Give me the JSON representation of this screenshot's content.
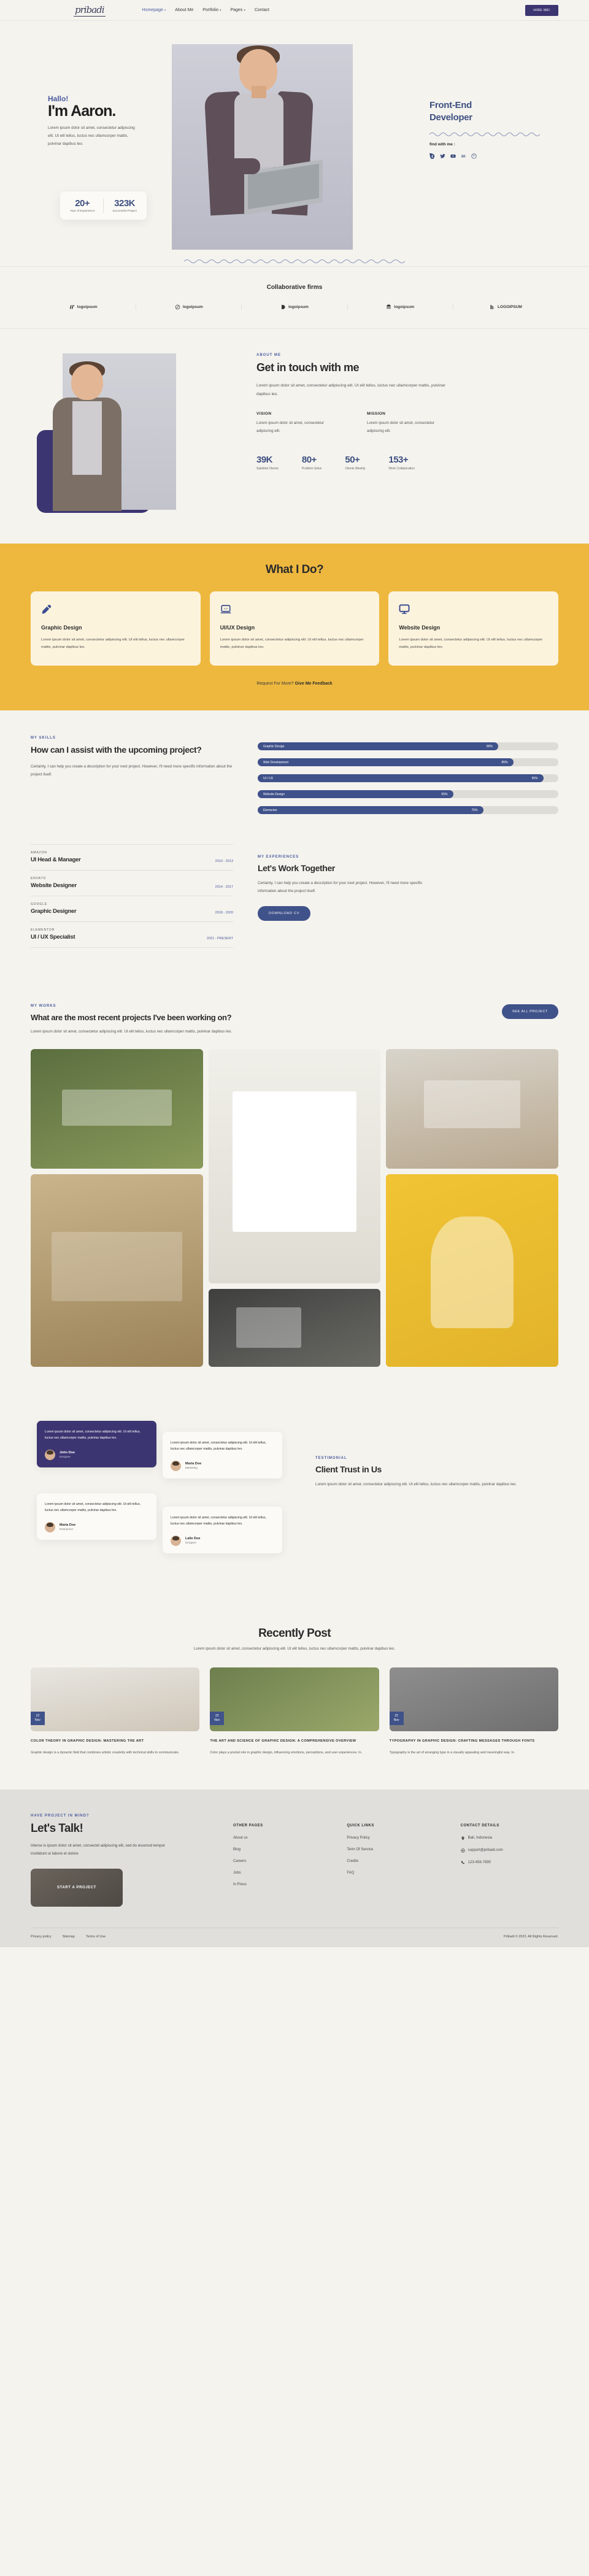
{
  "nav": {
    "logo": "pribadi",
    "items": [
      {
        "label": "Homepage",
        "caret": true,
        "active": true
      },
      {
        "label": "About Me",
        "caret": false,
        "active": false
      },
      {
        "label": "Portfolio",
        "caret": true,
        "active": false
      },
      {
        "label": "Pages",
        "caret": true,
        "active": false
      },
      {
        "label": "Contact",
        "caret": false,
        "active": false
      }
    ],
    "cta": "HIRE ME!"
  },
  "hero": {
    "greeting": "Hallo!",
    "name": "I'm Aaron.",
    "description": "Lorem ipsum dolor sit amet, consectetur adipiscing elit. Ut elit tellus, luctus nec ullamcorper mattis, pulvinar dapibus leo.",
    "stats": [
      {
        "value": "20+",
        "label": "Year of Experience"
      },
      {
        "value": "323K",
        "label": "Successful Project"
      }
    ],
    "role_line1": "Front-End",
    "role_line2": "Developer",
    "find_label": "find with me :",
    "socials": [
      "facebook-icon",
      "twitter-icon",
      "youtube-icon",
      "behance-icon",
      "pinterest-icon"
    ]
  },
  "collab": {
    "title": "Collaborative firms",
    "logos": [
      {
        "name": "logoipsum",
        "mark": "slashes-mark"
      },
      {
        "name": "logoipsum",
        "mark": "circle-slash-mark"
      },
      {
        "name": "logoipsum",
        "mark": "half-circle-mark"
      },
      {
        "name": "logoipsum",
        "mark": "waves-mark"
      },
      {
        "name": "LOGOIPSUM",
        "mark": "bars-mark"
      }
    ]
  },
  "about": {
    "eyebrow": "ABOUT ME",
    "title": "Get in touch with me",
    "paragraph": "Lorem ipsum dolor sit amet, consectetur adipiscing elit. Ut elit tellus, luctus nec ullamcorper mattis, pulvinar dapibus leo.",
    "blocks": [
      {
        "heading": "VISION",
        "text": "Lorem ipsum dolor sit amet, consectetur adipiscing elit."
      },
      {
        "heading": "MISSION",
        "text": "Lorem ipsum dolor sit amet, consectetur adipiscing elit."
      }
    ],
    "stats": [
      {
        "value": "39K",
        "label": "Satisfied Clients"
      },
      {
        "value": "80+",
        "label": "Problem Solve"
      },
      {
        "value": "50+",
        "label": "Clients Weekly"
      },
      {
        "value": "153+",
        "label": "Work Collaboration"
      }
    ]
  },
  "services": {
    "title": "What I Do?",
    "cards": [
      {
        "icon": "pen-icon",
        "title": "Graphic Design",
        "text": "Lorem ipsum dolor sit amet, consectetur adipiscing elit. Ut elit tellus, luctus nec ullamcorper mattis, pulvinar dapibus leo."
      },
      {
        "icon": "laptop-code-icon",
        "title": "UI/UX Design",
        "text": "Lorem ipsum dolor sit amet, consectetur adipiscing elit. Ut elit tellus, luctus nec ullamcorper mattis, pulvinar dapibus leo."
      },
      {
        "icon": "monitor-icon",
        "title": "Website Design",
        "text": "Lorem ipsum dolor sit amet, consectetur adipiscing elit. Ut elit tellus, luctus nec ullamcorper mattis, pulvinar dapibus leo."
      }
    ],
    "footer_text": "Request For More?",
    "footer_link": "Give Me Feedback"
  },
  "skills": {
    "eyebrow": "MY SKILLS",
    "title": "How can I assist with the upcoming project?",
    "paragraph": "Certainly, I can help you create a description for your next project. However, I'll need more specific information about the project itself.",
    "bars": [
      {
        "name": "Graphic Design",
        "percent": "80%",
        "value": 80
      },
      {
        "name": "Web Development",
        "percent": "85%",
        "value": 85
      },
      {
        "name": "UI / UX",
        "percent": "95%",
        "value": 95
      },
      {
        "name": "Website Design",
        "percent": "65%",
        "value": 65
      },
      {
        "name": "Elementor",
        "percent": "75%",
        "value": 75
      }
    ]
  },
  "experience": {
    "items": [
      {
        "company": "AMAZON",
        "title": "UI Head & Manager",
        "years": "2010 - 2013"
      },
      {
        "company": "ENVATO",
        "title": "Website Designer",
        "years": "2014 - 2017"
      },
      {
        "company": "GOOGLE",
        "title": "Graphic Designer",
        "years": "2018 - 2020"
      },
      {
        "company": "ELEMENTOR",
        "title": "UI / UX Specialist",
        "years": "2021 - PRESENT"
      }
    ],
    "eyebrow": "MY EXPERIENCES",
    "title": "Let's Work Together",
    "paragraph": "Certainly, I can help you create a description for your next project. However, I'll need more specific information about the project itself.",
    "cta": "DOWNLOAD CV"
  },
  "works": {
    "eyebrow": "MY WORKS",
    "title": "What are the most recent projects I've been working on?",
    "paragraph": "Lorem ipsum dolor sit amet, consectetur adipiscing elit. Ut elit tellus, luctus nec ullamcorper mattis, pulvinar dapibus leo.",
    "cta": "SEE ALL PROJECT"
  },
  "testimonials": {
    "cards": [
      {
        "text": "Lorem ipsum dolor sit amet, consectetur adipiscing elit. Ut elit tellus, luctus nec ullamcorper mattis, pulvinar dapibus leo.",
        "name": "John Doe",
        "role": "Designer",
        "theme": "dark"
      },
      {
        "text": "Lorem ipsum dolor sit amet, consectetur adipiscing elit. Ut elit tellus, luctus nec ullamcorper mattis, pulvinar dapibus leo.",
        "name": "Maria Doe",
        "role": "Marketing",
        "theme": "light"
      },
      {
        "text": "Lorem ipsum dolor sit amet, consectetur adipiscing elit. Ut elit tellus, luctus nec ullamcorper mattis, pulvinar dapibus leo.",
        "name": "Maria Doe",
        "role": "Enterpriner",
        "theme": "light"
      },
      {
        "text": "Lorem ipsum dolor sit amet, consectetur adipiscing elit. Ut elit tellus, luctus nec ullamcorper mattis, pulvinar dapibus leo.",
        "name": "Lalle Doe",
        "role": "Designer",
        "theme": "light"
      }
    ],
    "eyebrow": "TESTIMONIAL",
    "title": "Client Trust in Us",
    "paragraph": "Lorem ipsum dolor sit amet, consectetur adipiscing elit. Ut elit tellus, luctus nec ullamcorper mattis, pulvinar dapibus leo."
  },
  "blog": {
    "title": "Recently Post",
    "subtitle": "Lorem ipsum dolor sit amet, consectetur adipiscing elit. Ut elit tellus, luctus nec ullamcorper mattis, pulvinar dapibus leo.",
    "posts": [
      {
        "day": "22",
        "month": "Nov",
        "title": "COLOR THEORY IN GRAPHIC DESIGN: MASTERING THE ART",
        "text": "Graphic design is a dynamic field that combines artistic creativity with technical skills to communicate."
      },
      {
        "day": "22",
        "month": "Nov",
        "title": "THE ART AND SCIENCE OF GRAPHIC DESIGN: A COMPREHENSIVE OVERVIEW",
        "text": "Color plays a pivotal role in graphic design, influencing emotions, perceptions, and user experiences. In."
      },
      {
        "day": "22",
        "month": "Nov",
        "title": "TYPOGRAPHY IN GRAPHIC DESIGN: CRAFTING MESSAGES THROUGH FONTS",
        "text": "Typography is the art of arranging type in a visually appealing and meaningful way. In."
      }
    ]
  },
  "footer": {
    "eyebrow": "HAVE PROJECT IN MIND?",
    "title": "Let's Talk!",
    "paragraph": "Interse is ipsum dolor sit amet, consectet adipiscing elit, sed do eiusmod tempor incididunt ut labore et dolore",
    "cta": "START A PROJECT",
    "columns": [
      {
        "heading": "OTHER PAGES",
        "links": [
          {
            "label": "About us"
          },
          {
            "label": "Blog"
          },
          {
            "label": "Careers"
          },
          {
            "label": "Jobs"
          },
          {
            "label": "In Press"
          }
        ]
      },
      {
        "heading": "QUICK LINKS",
        "links": [
          {
            "label": "Privacy Policy"
          },
          {
            "label": "Term Of Service"
          },
          {
            "label": "Credits"
          },
          {
            "label": "FAQ"
          }
        ]
      },
      {
        "heading": "CONTACT DETAILS",
        "links": [
          {
            "label": "Bali, Indonesia",
            "icon": "location-icon"
          },
          {
            "label": "support@pribadi.com",
            "icon": "mail-icon"
          },
          {
            "label": "123-456-7890",
            "icon": "phone-icon"
          }
        ]
      }
    ],
    "bottom_links": [
      "Privacy policy",
      "Sitemap",
      "Terms of Use"
    ],
    "copyright": "Pribadi © 2023. All Rights Reserved."
  },
  "colors": {
    "bg": "#f4f3ee",
    "accent_purple": "#3b3571",
    "accent_blue": "#40528a",
    "accent_yellow": "#eeb83f",
    "card_cream": "#fcf3dd"
  }
}
